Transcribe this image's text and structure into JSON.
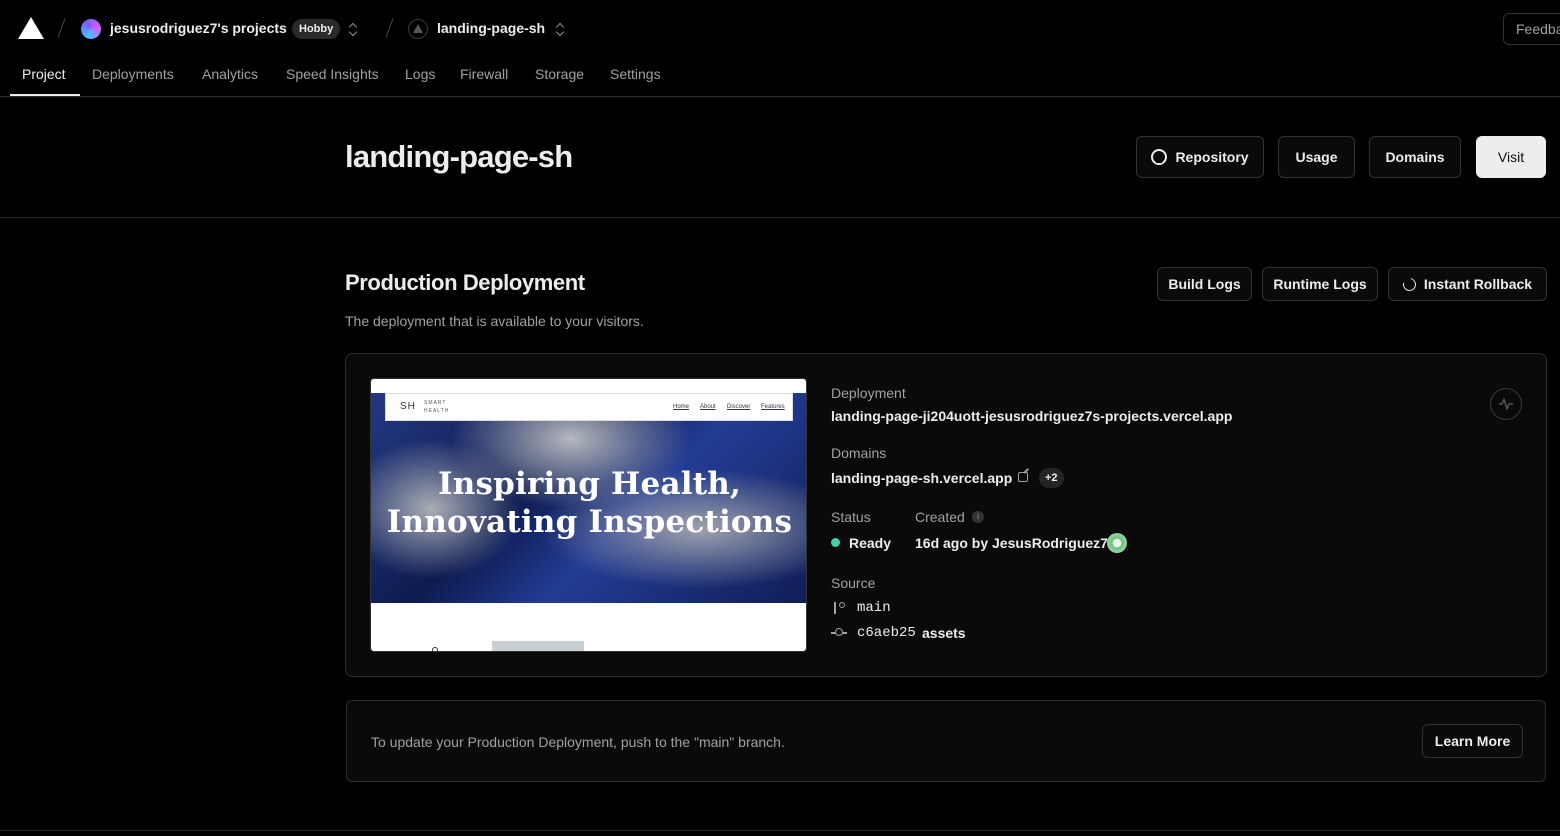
{
  "topbar": {
    "team_name": "jesusrodriguez7's projects",
    "plan_badge": "Hobby",
    "project_name": "landing-page-sh",
    "feedback_label": "Feedback"
  },
  "tabs": [
    {
      "label": "Project",
      "active": true
    },
    {
      "label": "Deployments"
    },
    {
      "label": "Analytics"
    },
    {
      "label": "Speed Insights"
    },
    {
      "label": "Logs"
    },
    {
      "label": "Firewall"
    },
    {
      "label": "Storage"
    },
    {
      "label": "Settings"
    }
  ],
  "header": {
    "title": "landing-page-sh",
    "buttons": {
      "repository": "Repository",
      "usage": "Usage",
      "domains": "Domains",
      "visit": "Visit"
    }
  },
  "production": {
    "title": "Production Deployment",
    "subtitle": "The deployment that is available to your visitors.",
    "actions": {
      "build_logs": "Build Logs",
      "runtime_logs": "Runtime Logs",
      "instant_rollback": "Instant Rollback"
    },
    "preview": {
      "logo": "SH",
      "logo_sub_1": "SMART",
      "logo_sub_2": "HEALTH",
      "nav": [
        "Home",
        "About",
        "Discover",
        "Features"
      ],
      "heading_1": "Inspiring Health,",
      "heading_2": "Innovating Inspections"
    },
    "details": {
      "deployment_label": "Deployment",
      "deployment_url": "landing-page-ji204uott-jesusrodriguez7s-projects.vercel.app",
      "domains_label": "Domains",
      "domain": "landing-page-sh.vercel.app",
      "domains_extra": "+2",
      "status_label": "Status",
      "status_value": "Ready",
      "status_color": "#3fd2a8",
      "created_label": "Created",
      "created_value": "16d ago by JesusRodriguez7",
      "source_label": "Source",
      "branch": "main",
      "commit_hash": "c6aeb25",
      "commit_message": "assets"
    }
  },
  "banner": {
    "text": "To update your Production Deployment, push to the \"main\" branch.",
    "learn_more": "Learn More"
  }
}
